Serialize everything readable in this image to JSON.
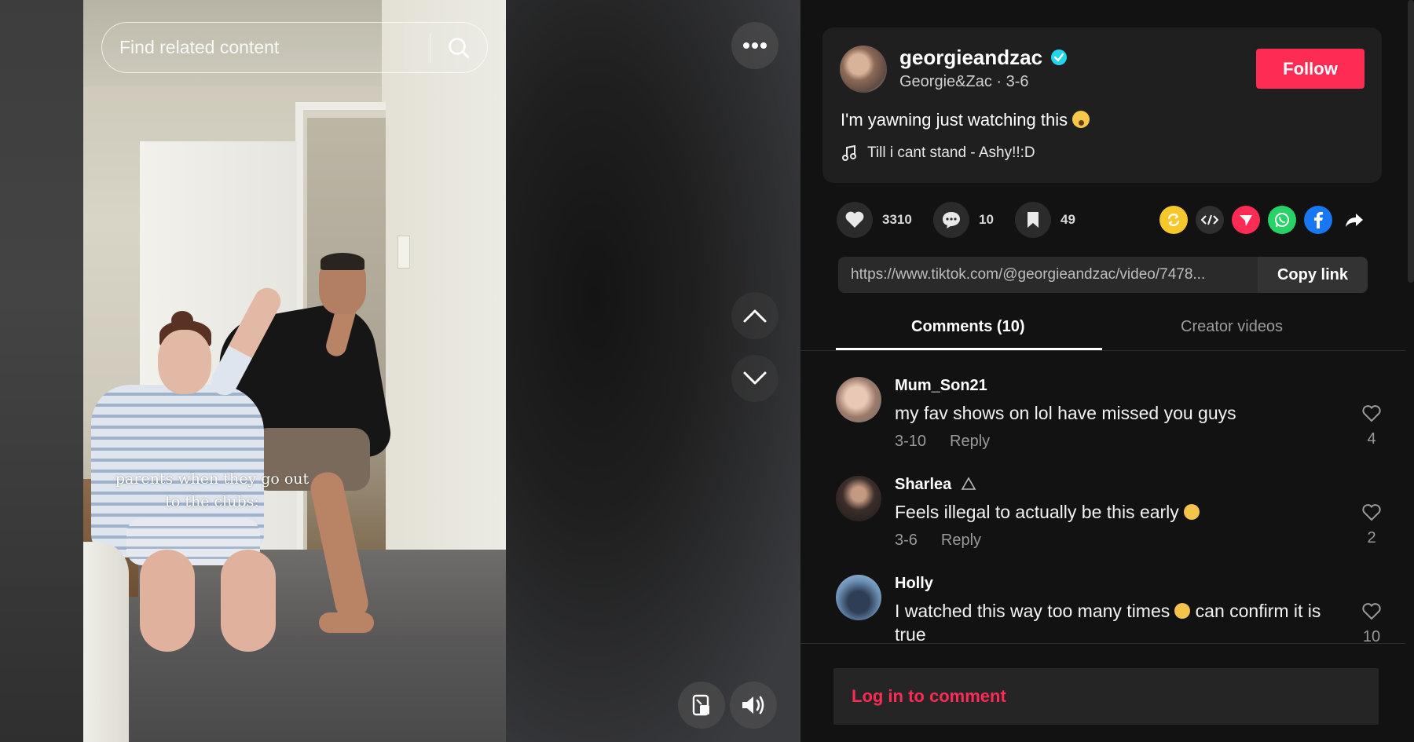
{
  "video": {
    "search_placeholder": "Find related content",
    "caption": "parents when they go out to the clubs:"
  },
  "icons": {
    "more": "more-horizontal-icon",
    "search": "search-icon",
    "up": "chevron-up-icon",
    "down": "chevron-down-icon",
    "float": "floating-player-icon",
    "volume": "volume-icon"
  },
  "author": {
    "username": "georgieandzac",
    "display_name": "Georgie&Zac",
    "date": "3-6",
    "meta": "Georgie&Zac · 3-6",
    "verified": true,
    "follow_label": "Follow"
  },
  "post": {
    "description": "I'm yawning just watching this",
    "music": "Till i cant stand - Ashy!!:D"
  },
  "stats": {
    "likes": "3310",
    "comments": "10",
    "saves": "49"
  },
  "share": {
    "link": "https://www.tiktok.com/@georgieandzac/video/7478...",
    "copy_label": "Copy link",
    "targets": [
      "repost",
      "embed",
      "send-to-friends",
      "whatsapp",
      "facebook",
      "share-more"
    ]
  },
  "tabs": {
    "comments": "Comments (10)",
    "creator_videos": "Creator videos"
  },
  "comments": [
    {
      "user": "Mum_Son21",
      "text": "my fav shows on lol have missed you guys",
      "date": "3-10",
      "reply": "Reply",
      "likes": "4"
    },
    {
      "user": "Sharlea",
      "text": "Feels illegal to actually be this early",
      "date": "3-6",
      "reply": "Reply",
      "likes": "2"
    },
    {
      "user": "Holly",
      "text_a": "I watched this way too many times",
      "text_b": "can confirm it is true",
      "likes": "10"
    }
  ],
  "login_prompt": "Log in to comment",
  "colors": {
    "accent": "#fe2c55",
    "panel_bg": "#121212",
    "card_bg": "#1f1f1f",
    "verified": "#20d5ec"
  }
}
